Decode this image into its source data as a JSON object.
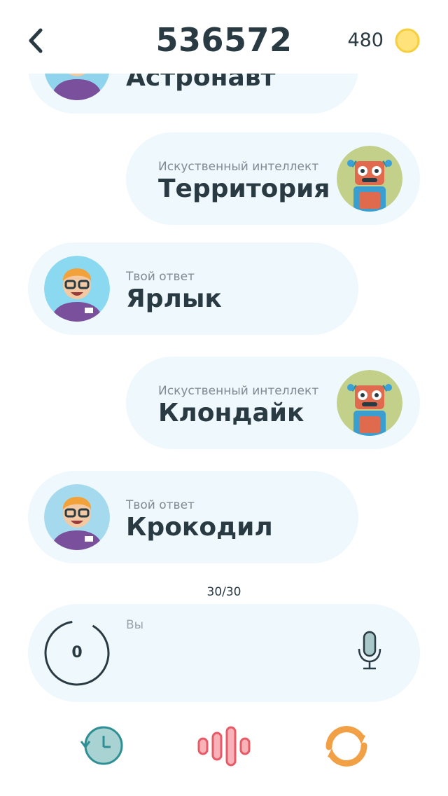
{
  "header": {
    "title": "536572",
    "coins": "480"
  },
  "messages": [
    {
      "side": "left",
      "author": "",
      "word": "Астронавт",
      "avatar": "player-avatar"
    },
    {
      "side": "right",
      "author": "Искуственный интеллект",
      "word": "Территория",
      "avatar": "robot-avatar"
    },
    {
      "side": "left",
      "author": "Твой ответ",
      "word": "Ярлык",
      "avatar": "player-avatar"
    },
    {
      "side": "right",
      "author": "Искуственный интеллект",
      "word": "Клондайк",
      "avatar": "robot-avatar"
    },
    {
      "side": "left",
      "author": "Твой ответ",
      "word": "Крокодил",
      "avatar": "player-avatar"
    }
  ],
  "counter": "30/30",
  "input": {
    "label": "Вы",
    "timer": "0"
  },
  "toolbar": {
    "history_icon": "history-icon",
    "sound_icon": "sound-wave-icon",
    "refresh_icon": "refresh-icon"
  },
  "colors": {
    "bubble": "#eef8fd",
    "coin": "#ffe37a",
    "teal": "#2f8f95",
    "red": "#e85a66",
    "orange": "#f2a046",
    "text": "#2a3a43"
  }
}
